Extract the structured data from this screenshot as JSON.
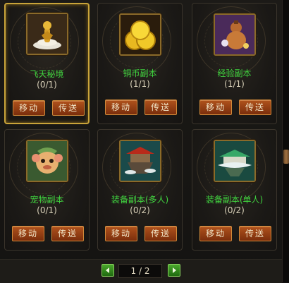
{
  "dungeons": [
    {
      "name": "飞天秘境",
      "count": "(0/1)",
      "icon": "golden-statue-icon",
      "selected": true
    },
    {
      "name": "铜币副本",
      "count": "(1/1)",
      "icon": "gold-coins-icon",
      "selected": false
    },
    {
      "name": "经验副本",
      "count": "(1/1)",
      "icon": "experience-gourd-icon",
      "selected": false
    },
    {
      "name": "宠物副本",
      "count": "(0/1)",
      "icon": "pet-monkey-icon",
      "selected": false
    },
    {
      "name": "装备副本(多人)",
      "count": "(0/2)",
      "icon": "floating-palace-icon",
      "selected": false
    },
    {
      "name": "装备副本(单人)",
      "count": "(0/2)",
      "icon": "floating-pavilion-icon",
      "selected": false
    }
  ],
  "buttons": {
    "move": "移动",
    "teleport": "传送"
  },
  "pager": {
    "text": "1 / 2"
  },
  "colors": {
    "name_green": "#3fd23f",
    "button": "#9a3e14",
    "frame_gold": "#c9a43a"
  }
}
